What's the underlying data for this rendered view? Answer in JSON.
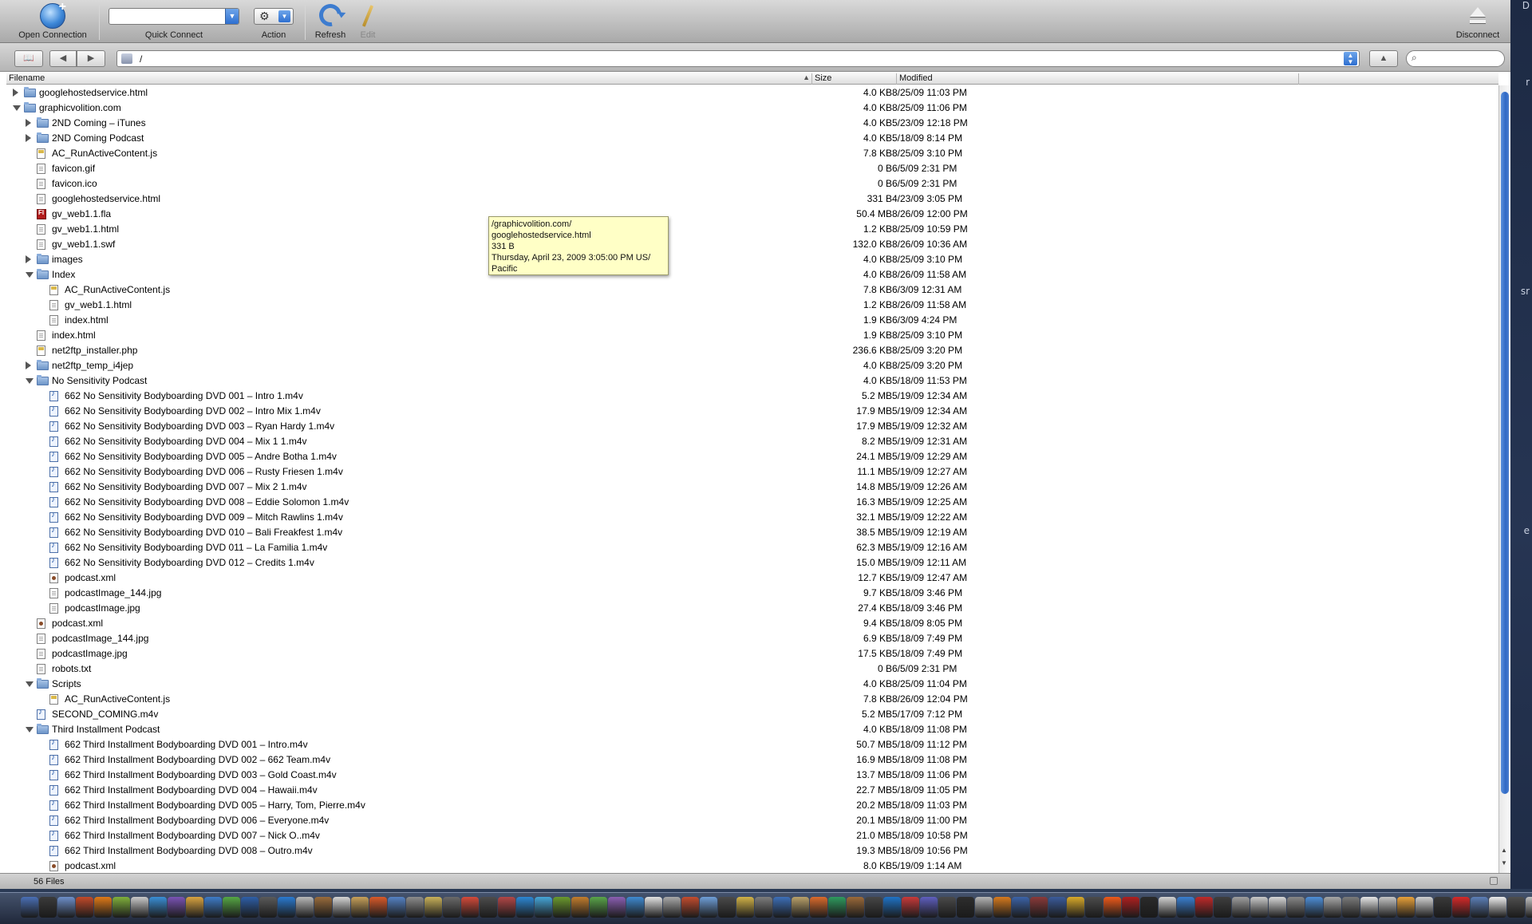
{
  "toolbar": {
    "open_connection": "Open Connection",
    "quick_connect": "Quick Connect",
    "quick_connect_value": "",
    "action": "Action",
    "refresh": "Refresh",
    "edit": "Edit",
    "disconnect": "Disconnect"
  },
  "navbar": {
    "path": "/",
    "search_placeholder": ""
  },
  "columns": {
    "filename": "Filename",
    "size": "Size",
    "modified": "Modified"
  },
  "rows": [
    {
      "level": 0,
      "disclosure": "closed",
      "icon": "folder",
      "name": "googlehostedservice.html",
      "size": "4.0 KB",
      "modified": "8/25/09 11:03 PM"
    },
    {
      "level": 0,
      "disclosure": "open",
      "icon": "folder",
      "name": "graphicvolition.com",
      "size": "4.0 KB",
      "modified": "8/25/09 11:06 PM"
    },
    {
      "level": 1,
      "disclosure": "closed",
      "icon": "folder",
      "name": "2ND Coming – iTunes",
      "size": "4.0 KB",
      "modified": "5/23/09 12:18 PM"
    },
    {
      "level": 1,
      "disclosure": "closed",
      "icon": "folder",
      "name": "2ND Coming Podcast",
      "size": "4.0 KB",
      "modified": "5/18/09 8:14 PM"
    },
    {
      "level": 1,
      "disclosure": "none",
      "icon": "script",
      "name": "AC_RunActiveContent.js",
      "size": "7.8 KB",
      "modified": "8/25/09 3:10 PM"
    },
    {
      "level": 1,
      "disclosure": "none",
      "icon": "file",
      "name": "favicon.gif",
      "size": "0 B",
      "modified": "6/5/09 2:31 PM"
    },
    {
      "level": 1,
      "disclosure": "none",
      "icon": "file",
      "name": "favicon.ico",
      "size": "0 B",
      "modified": "6/5/09 2:31 PM"
    },
    {
      "level": 1,
      "disclosure": "none",
      "icon": "file",
      "name": "googlehostedservice.html",
      "size": "331 B",
      "modified": "4/23/09 3:05 PM"
    },
    {
      "level": 1,
      "disclosure": "none",
      "icon": "fla",
      "name": "gv_web1.1.fla",
      "size": "50.4 MB",
      "modified": "8/26/09 12:00 PM"
    },
    {
      "level": 1,
      "disclosure": "none",
      "icon": "file",
      "name": "gv_web1.1.html",
      "size": "1.2 KB",
      "modified": "8/25/09 10:59 PM"
    },
    {
      "level": 1,
      "disclosure": "none",
      "icon": "file",
      "name": "gv_web1.1.swf",
      "size": "132.0 KB",
      "modified": "8/26/09 10:36 AM"
    },
    {
      "level": 1,
      "disclosure": "closed",
      "icon": "folder",
      "name": "images",
      "size": "4.0 KB",
      "modified": "8/25/09 3:10 PM"
    },
    {
      "level": 1,
      "disclosure": "open",
      "icon": "folder",
      "name": "Index",
      "size": "4.0 KB",
      "modified": "8/26/09 11:58 AM"
    },
    {
      "level": 2,
      "disclosure": "none",
      "icon": "script",
      "name": "AC_RunActiveContent.js",
      "size": "7.8 KB",
      "modified": "6/3/09 12:31 AM"
    },
    {
      "level": 2,
      "disclosure": "none",
      "icon": "file",
      "name": "gv_web1.1.html",
      "size": "1.2 KB",
      "modified": "8/26/09 11:58 AM"
    },
    {
      "level": 2,
      "disclosure": "none",
      "icon": "file",
      "name": "index.html",
      "size": "1.9 KB",
      "modified": "6/3/09 4:24 PM"
    },
    {
      "level": 1,
      "disclosure": "none",
      "icon": "file",
      "name": "index.html",
      "size": "1.9 KB",
      "modified": "8/25/09 3:10 PM"
    },
    {
      "level": 1,
      "disclosure": "none",
      "icon": "script",
      "name": "net2ftp_installer.php",
      "size": "236.6 KB",
      "modified": "8/25/09 3:20 PM"
    },
    {
      "level": 1,
      "disclosure": "closed",
      "icon": "folder",
      "name": "net2ftp_temp_i4jep",
      "size": "4.0 KB",
      "modified": "8/25/09 3:20 PM"
    },
    {
      "level": 1,
      "disclosure": "open",
      "icon": "folder",
      "name": "No Sensitivity Podcast",
      "size": "4.0 KB",
      "modified": "5/18/09 11:53 PM"
    },
    {
      "level": 2,
      "disclosure": "none",
      "icon": "media",
      "name": "662 No Sensitivity Bodyboarding DVD 001 – Intro 1.m4v",
      "size": "5.2 MB",
      "modified": "5/19/09 12:34 AM"
    },
    {
      "level": 2,
      "disclosure": "none",
      "icon": "media",
      "name": "662 No Sensitivity Bodyboarding DVD 002 – Intro Mix 1.m4v",
      "size": "17.9 MB",
      "modified": "5/19/09 12:34 AM"
    },
    {
      "level": 2,
      "disclosure": "none",
      "icon": "media",
      "name": "662 No Sensitivity Bodyboarding DVD 003 – Ryan Hardy 1.m4v",
      "size": "17.9 MB",
      "modified": "5/19/09 12:32 AM"
    },
    {
      "level": 2,
      "disclosure": "none",
      "icon": "media",
      "name": "662 No Sensitivity Bodyboarding DVD 004 – Mix 1 1.m4v",
      "size": "8.2 MB",
      "modified": "5/19/09 12:31 AM"
    },
    {
      "level": 2,
      "disclosure": "none",
      "icon": "media",
      "name": "662 No Sensitivity Bodyboarding DVD 005 – Andre Botha 1.m4v",
      "size": "24.1 MB",
      "modified": "5/19/09 12:29 AM"
    },
    {
      "level": 2,
      "disclosure": "none",
      "icon": "media",
      "name": "662 No Sensitivity Bodyboarding DVD 006 – Rusty Friesen 1.m4v",
      "size": "11.1 MB",
      "modified": "5/19/09 12:27 AM"
    },
    {
      "level": 2,
      "disclosure": "none",
      "icon": "media",
      "name": "662 No Sensitivity Bodyboarding DVD 007 – Mix 2 1.m4v",
      "size": "14.8 MB",
      "modified": "5/19/09 12:26 AM"
    },
    {
      "level": 2,
      "disclosure": "none",
      "icon": "media",
      "name": "662 No Sensitivity Bodyboarding DVD 008 – Eddie Solomon 1.m4v",
      "size": "16.3 MB",
      "modified": "5/19/09 12:25 AM"
    },
    {
      "level": 2,
      "disclosure": "none",
      "icon": "media",
      "name": "662 No Sensitivity Bodyboarding DVD 009 – Mitch Rawlins 1.m4v",
      "size": "32.1 MB",
      "modified": "5/19/09 12:22 AM"
    },
    {
      "level": 2,
      "disclosure": "none",
      "icon": "media",
      "name": "662 No Sensitivity Bodyboarding DVD 010 – Bali Freakfest 1.m4v",
      "size": "38.5 MB",
      "modified": "5/19/09 12:19 AM"
    },
    {
      "level": 2,
      "disclosure": "none",
      "icon": "media",
      "name": "662 No Sensitivity Bodyboarding DVD 011 – La Familia 1.m4v",
      "size": "62.3 MB",
      "modified": "5/19/09 12:16 AM"
    },
    {
      "level": 2,
      "disclosure": "none",
      "icon": "media",
      "name": "662 No Sensitivity Bodyboarding DVD 012 – Credits 1.m4v",
      "size": "15.0 MB",
      "modified": "5/19/09 12:11 AM"
    },
    {
      "level": 2,
      "disclosure": "none",
      "icon": "xml",
      "name": "podcast.xml",
      "size": "12.7 KB",
      "modified": "5/19/09 12:47 AM"
    },
    {
      "level": 2,
      "disclosure": "none",
      "icon": "file",
      "name": "podcastImage_144.jpg",
      "size": "9.7 KB",
      "modified": "5/18/09 3:46 PM"
    },
    {
      "level": 2,
      "disclosure": "none",
      "icon": "file",
      "name": "podcastImage.jpg",
      "size": "27.4 KB",
      "modified": "5/18/09 3:46 PM"
    },
    {
      "level": 1,
      "disclosure": "none",
      "icon": "xml",
      "name": "podcast.xml",
      "size": "9.4 KB",
      "modified": "5/18/09 8:05 PM"
    },
    {
      "level": 1,
      "disclosure": "none",
      "icon": "file",
      "name": "podcastImage_144.jpg",
      "size": "6.9 KB",
      "modified": "5/18/09 7:49 PM"
    },
    {
      "level": 1,
      "disclosure": "none",
      "icon": "file",
      "name": "podcastImage.jpg",
      "size": "17.5 KB",
      "modified": "5/18/09 7:49 PM"
    },
    {
      "level": 1,
      "disclosure": "none",
      "icon": "file",
      "name": "robots.txt",
      "size": "0 B",
      "modified": "6/5/09 2:31 PM"
    },
    {
      "level": 1,
      "disclosure": "open",
      "icon": "folder",
      "name": "Scripts",
      "size": "4.0 KB",
      "modified": "8/25/09 11:04 PM"
    },
    {
      "level": 2,
      "disclosure": "none",
      "icon": "script",
      "name": "AC_RunActiveContent.js",
      "size": "7.8 KB",
      "modified": "8/26/09 12:04 PM"
    },
    {
      "level": 1,
      "disclosure": "none",
      "icon": "media",
      "name": "SECOND_COMING.m4v",
      "size": "5.2 MB",
      "modified": "5/17/09 7:12 PM"
    },
    {
      "level": 1,
      "disclosure": "open",
      "icon": "folder",
      "name": "Third Installment Podcast",
      "size": "4.0 KB",
      "modified": "5/18/09 11:08 PM"
    },
    {
      "level": 2,
      "disclosure": "none",
      "icon": "media",
      "name": "662 Third Installment Bodyboarding DVD 001 – Intro.m4v",
      "size": "50.7 MB",
      "modified": "5/18/09 11:12 PM"
    },
    {
      "level": 2,
      "disclosure": "none",
      "icon": "media",
      "name": "662 Third Installment Bodyboarding DVD 002 – 662 Team.m4v",
      "size": "16.9 MB",
      "modified": "5/18/09 11:08 PM"
    },
    {
      "level": 2,
      "disclosure": "none",
      "icon": "media",
      "name": "662 Third Installment Bodyboarding DVD 003 – Gold Coast.m4v",
      "size": "13.7 MB",
      "modified": "5/18/09 11:06 PM"
    },
    {
      "level": 2,
      "disclosure": "none",
      "icon": "media",
      "name": "662 Third Installment Bodyboarding DVD 004 – Hawaii.m4v",
      "size": "22.7 MB",
      "modified": "5/18/09 11:05 PM"
    },
    {
      "level": 2,
      "disclosure": "none",
      "icon": "media",
      "name": "662 Third Installment Bodyboarding DVD 005 – Harry, Tom, Pierre.m4v",
      "size": "20.2 MB",
      "modified": "5/18/09 11:03 PM"
    },
    {
      "level": 2,
      "disclosure": "none",
      "icon": "media",
      "name": "662 Third Installment Bodyboarding DVD 006 – Everyone.m4v",
      "size": "20.1 MB",
      "modified": "5/18/09 11:00 PM"
    },
    {
      "level": 2,
      "disclosure": "none",
      "icon": "media",
      "name": "662 Third Installment Bodyboarding DVD 007 – Nick O..m4v",
      "size": "21.0 MB",
      "modified": "5/18/09 10:58 PM"
    },
    {
      "level": 2,
      "disclosure": "none",
      "icon": "media",
      "name": "662 Third Installment Bodyboarding DVD 008 – Outro.m4v",
      "size": "19.3 MB",
      "modified": "5/18/09 10:56 PM"
    },
    {
      "level": 2,
      "disclosure": "none",
      "icon": "xml",
      "name": "podcast.xml",
      "size": "8.0 KB",
      "modified": "5/19/09 1:14 AM"
    }
  ],
  "tooltip": {
    "line1": "/graphicvolition.com/",
    "line2": "googlehostedservice.html",
    "line3": "331 B",
    "line4": "Thursday, April 23, 2009 3:05:00 PM US/",
    "line5": "Pacific"
  },
  "status": {
    "count": "56 Files"
  },
  "desktop_fragments": [
    "D",
    "r",
    "sr",
    "e"
  ],
  "dock_colors": [
    "#4a6fb5",
    "#3b3b3b",
    "#6d8fc9",
    "#c24a2a",
    "#e07a18",
    "#7fb03c",
    "#c9c9c9",
    "#3a8fd6",
    "#7a53b5",
    "#d9a441",
    "#3e7cc8",
    "#56a845",
    "#2e5fa8",
    "#5a5a5a",
    "#2a7ad0",
    "#b8b8b8",
    "#9a6c3c",
    "#d5d5d5",
    "#c7a15a",
    "#d95a2a",
    "#5582c4",
    "#8c8c8c",
    "#c8b15a",
    "#6a6a6a",
    "#d44b3b",
    "#4d4d4d",
    "#b34747",
    "#2c87d4",
    "#46a6d8",
    "#6b9a2e",
    "#c27d2e",
    "#5aa54a",
    "#8b5fb2",
    "#3f8ad1",
    "#e2e2e2",
    "#a9a9a9",
    "#c34d2f",
    "#6f9fd8",
    "#4b4b4b",
    "#d2b348",
    "#7d7d7d",
    "#3d6fb8",
    "#b9a16a",
    "#db6b2c",
    "#2f9b5f",
    "#9c6a3a",
    "#474747",
    "#1f73c7",
    "#c83a3a",
    "#5f5fbf",
    "#4a4a4a",
    "#2e2e2e",
    "#b5b5b5",
    "#d67a1e",
    "#3c63a8",
    "#8a3a3a",
    "#3b5b9b",
    "#d9aa2a",
    "#4c4c4c",
    "#ef5a1a",
    "#b02020",
    "#2b2b2b",
    "#d2d2d2",
    "#3a7fd0",
    "#c02a2a",
    "#3f3f3f",
    "#9f9f9f",
    "#c9c9c9",
    "#d7d7d7",
    "#888888",
    "#4e8fd8",
    "#a7a7a7",
    "#7b7b7b",
    "#e6e6e6",
    "#c4c4c4",
    "#e8a13a",
    "#d0d0d0",
    "#3a3a3a",
    "#d62a2a",
    "#5c7fb8",
    "#ececec",
    "#4f4f4f",
    "#c2c2c2",
    "#8d8d8d"
  ]
}
